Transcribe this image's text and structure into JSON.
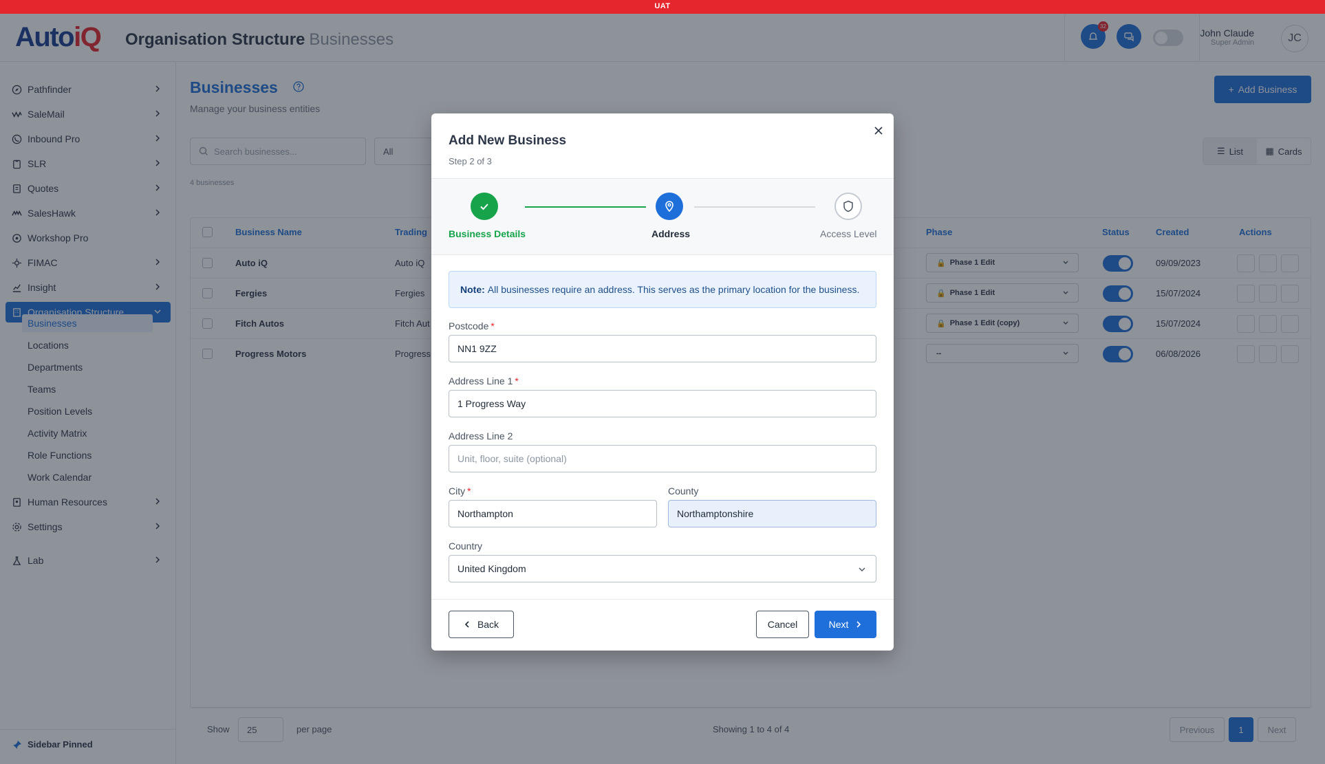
{
  "env_label": "UAT",
  "app": {
    "logo_main": "Auto",
    "logo_accent": "iQ",
    "title": "Organisation Structure",
    "subtitle": "Businesses",
    "notification_count": "32"
  },
  "user": {
    "name": "John Claude",
    "role": "Super Admin",
    "initials": "JC"
  },
  "sidebar": {
    "items": [
      {
        "label": "Pathfinder",
        "icon": "compass-icon",
        "has_chevron": true
      },
      {
        "label": "SaleMail",
        "icon": "mail-icon",
        "has_chevron": true
      },
      {
        "label": "Inbound Pro",
        "icon": "phone-icon",
        "has_chevron": true
      },
      {
        "label": "SLR",
        "icon": "clipboard-icon",
        "has_chevron": true
      },
      {
        "label": "Quotes",
        "icon": "document-icon",
        "has_chevron": true
      },
      {
        "label": "SalesHawk",
        "icon": "hawk-icon",
        "has_chevron": true
      },
      {
        "label": "Workshop Pro",
        "icon": "wrench-icon",
        "has_chevron": false
      },
      {
        "label": "FIMAC",
        "icon": "gauge-icon",
        "has_chevron": true
      },
      {
        "label": "Insight",
        "icon": "chart-icon",
        "has_chevron": true
      },
      {
        "label": "Organisation Structure",
        "icon": "building-icon",
        "has_chevron": true,
        "active": true
      }
    ],
    "sub_items": [
      "Businesses",
      "Locations",
      "Departments",
      "Teams",
      "Position Levels",
      "Activity Matrix",
      "Role Functions",
      "Work Calendar"
    ],
    "bottom_items": [
      {
        "label": "Human Resources",
        "icon": "id-card-icon"
      },
      {
        "label": "Settings",
        "icon": "gear-icon"
      },
      {
        "label": "Lab",
        "icon": "flask-icon"
      }
    ],
    "pinned_label": "Sidebar Pinned"
  },
  "page": {
    "title": "Businesses",
    "subtitle": "Manage your business entities",
    "add_button": "Add Business",
    "search_placeholder": "Search businesses...",
    "filter_value": "All",
    "view_list": "List",
    "view_cards": "Cards",
    "count_text": "4 businesses"
  },
  "table": {
    "headers": {
      "name": "Business Name",
      "trading": "Trading",
      "phase": "Phase",
      "status": "Status",
      "created": "Created",
      "actions": "Actions"
    },
    "rows": [
      {
        "name": "Auto iQ",
        "trading": "Auto iQ",
        "phase": "Phase 1 Edit",
        "created": "09/09/2023"
      },
      {
        "name": "Fergies",
        "trading": "Fergies",
        "phase": "Phase 1 Edit",
        "created": "15/07/2024"
      },
      {
        "name": "Fitch Autos",
        "trading": "Fitch Aut",
        "phase": "Phase 1 Edit (copy)",
        "created": "15/07/2024"
      },
      {
        "name": "Progress Motors",
        "trading": "Progress",
        "phase": "--",
        "created": "06/08/2026"
      }
    ],
    "footer": {
      "show": "Show",
      "per_page_value": "25",
      "per_page": "per page",
      "showing": "Showing 1 to 4 of 4",
      "previous": "Previous",
      "page": "1",
      "next": "Next"
    }
  },
  "modal": {
    "title": "Add New Business",
    "step_text": "Step 2 of 3",
    "steps": [
      {
        "label": "Business Details",
        "state": "complete"
      },
      {
        "label": "Address",
        "state": "current"
      },
      {
        "label": "Access Level",
        "state": "pending"
      }
    ],
    "note_bold": "Note:",
    "note_text": "All businesses require an address. This serves as the primary location for the business.",
    "fields": {
      "postcode": {
        "label": "Postcode",
        "value": "NN1 9ZZ"
      },
      "address1": {
        "label": "Address Line 1",
        "value": "1 Progress Way"
      },
      "address2": {
        "label": "Address Line 2",
        "placeholder": "Unit, floor, suite (optional)"
      },
      "city": {
        "label": "City",
        "value": "Northampton"
      },
      "county": {
        "label": "County",
        "value": "Northamptonshire"
      },
      "country": {
        "label": "Country",
        "value": "United Kingdom"
      }
    },
    "buttons": {
      "back": "Back",
      "cancel": "Cancel",
      "next": "Next"
    },
    "colors": {
      "complete": "#16a34a",
      "current": "#1e6fd9",
      "primary": "#1e6fd9"
    }
  }
}
